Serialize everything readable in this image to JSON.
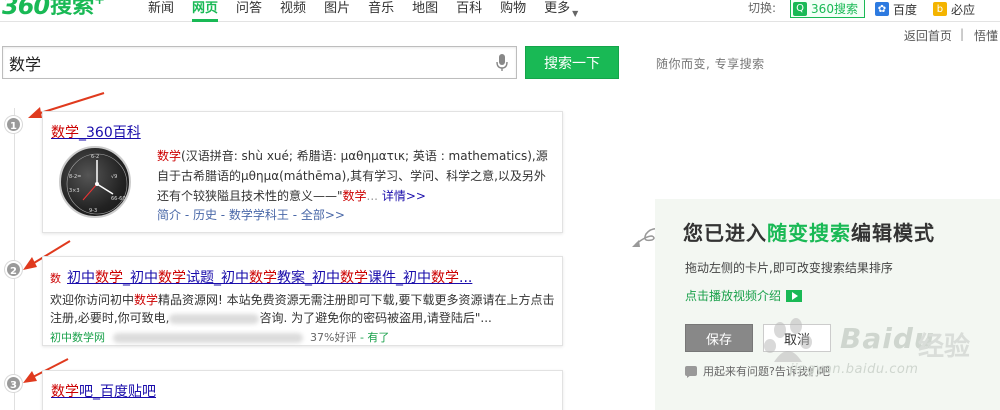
{
  "logo": {
    "num": "360",
    "cn": "搜索",
    "plus": "+"
  },
  "nav": {
    "items": [
      "新闻",
      "网页",
      "问答",
      "视频",
      "图片",
      "音乐",
      "地图",
      "百科",
      "购物"
    ],
    "active": 1,
    "more": "更多"
  },
  "switcher": {
    "label": "切换:",
    "engines": [
      {
        "label": "360搜索",
        "icon": "360-search-icon",
        "color": "#19b955"
      },
      {
        "label": "百度",
        "icon": "baidu-paw-icon",
        "color": "#2d7ae0"
      },
      {
        "label": "必应",
        "icon": "bing-icon",
        "color": "#f4b400"
      }
    ]
  },
  "sublinks": {
    "home": "返回首页",
    "other": "悟懂"
  },
  "search": {
    "value": "数学",
    "button": "搜索一下",
    "slogan": "随你而变, 专享搜索"
  },
  "results": [
    {
      "index": "1",
      "title_hl": "数学",
      "title_rest": "_360百科",
      "text_a": "数学",
      "text_b": "(汉语拼音: shù xué; 希腊语: μαθηματικ; 英语 : mathematics),源自于古希腊语的μθημα(máthēma),其有学习、学问、科学之意,以及另外还有个较狭隘且技术性的意义——\"",
      "text_c": "数学",
      "text_d": "...",
      "more_link": "详情>>",
      "links": "简介 - 历史 - 数学学科王 - 全部>>"
    },
    {
      "index": "2",
      "title_prefix": "数",
      "title_parts": [
        "初中",
        "数学",
        "_初中",
        "数学",
        "试题_初中",
        "数学",
        "教案_初中",
        "数学",
        "课件_初中",
        "数学",
        "..."
      ],
      "desc_a": "欢迎你访问初中",
      "desc_hl": "数学",
      "desc_b": "精品资源网! 本站免费资源无需注册即可下载,要下载更多资源请在上方点击注册,必要时,你可致电,",
      "desc_c": "咨询. 为了避免你的密码被盗用,请登陆后\"...",
      "url": "初中数学网",
      "rating": "37%好评",
      "extra": "- 有了"
    },
    {
      "index": "3",
      "title_hl": "数学",
      "title_rest": "吧_百度贴吧"
    }
  ],
  "edit_panel": {
    "title_a": "您已进入",
    "title_hl": "随变搜索",
    "title_b": "编辑模式",
    "desc": "拖动左侧的卡片,即可改变搜索结果排序",
    "video": "点击播放视频介绍",
    "save": "保存",
    "cancel": "取消",
    "help": "用起来有问题?告诉我们吧"
  },
  "watermark": {
    "brand": "Baidu",
    "cn": "经验",
    "url": "jingyan.baidu.com"
  },
  "colors": {
    "accent": "#19b955",
    "link": "#1a0dab",
    "highlight": "#cc0000"
  }
}
